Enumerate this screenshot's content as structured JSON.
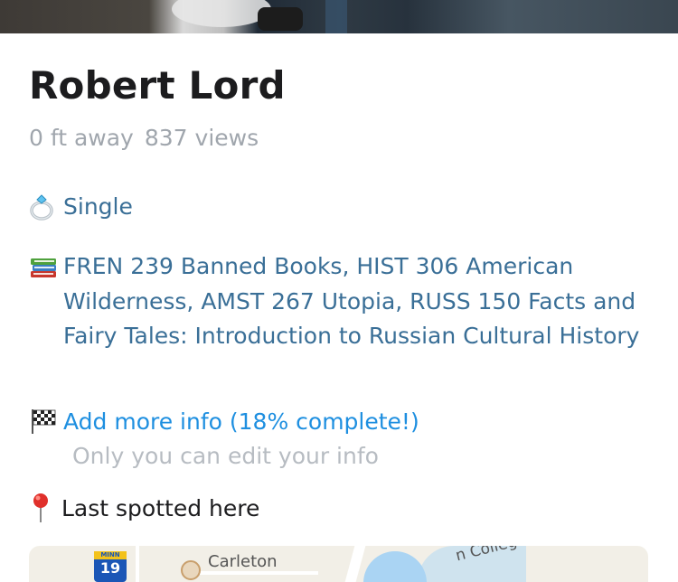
{
  "profile": {
    "name": "Robert Lord",
    "distance": "0 ft away",
    "views": "837 views"
  },
  "info": {
    "status_icon": "ring-icon",
    "status": "Single",
    "courses_icon": "books-icon",
    "courses": "FREN 239 Banned Books, HIST 306 American Wilderness, AMST 267 Utopia, RUSS 150 Facts and Fairy Tales: Introduction to Russian Cultural History",
    "add_icon": "checkered-flag-icon",
    "add_more": "Add more info (18% complete!)",
    "edit_note": "Only you can edit your info",
    "spotted_icon": "pushpin-icon",
    "last_spotted": "Last spotted here"
  },
  "map": {
    "shield_top": "MINN",
    "shield_num": "19",
    "label_carleton": "Carleton",
    "label_college": "n College"
  },
  "colors": {
    "name": "#1c1c1e",
    "meta": "#a0a6ad",
    "info_text": "#3a6f97",
    "link": "#1e8fe0",
    "note": "#b7bcc2"
  }
}
